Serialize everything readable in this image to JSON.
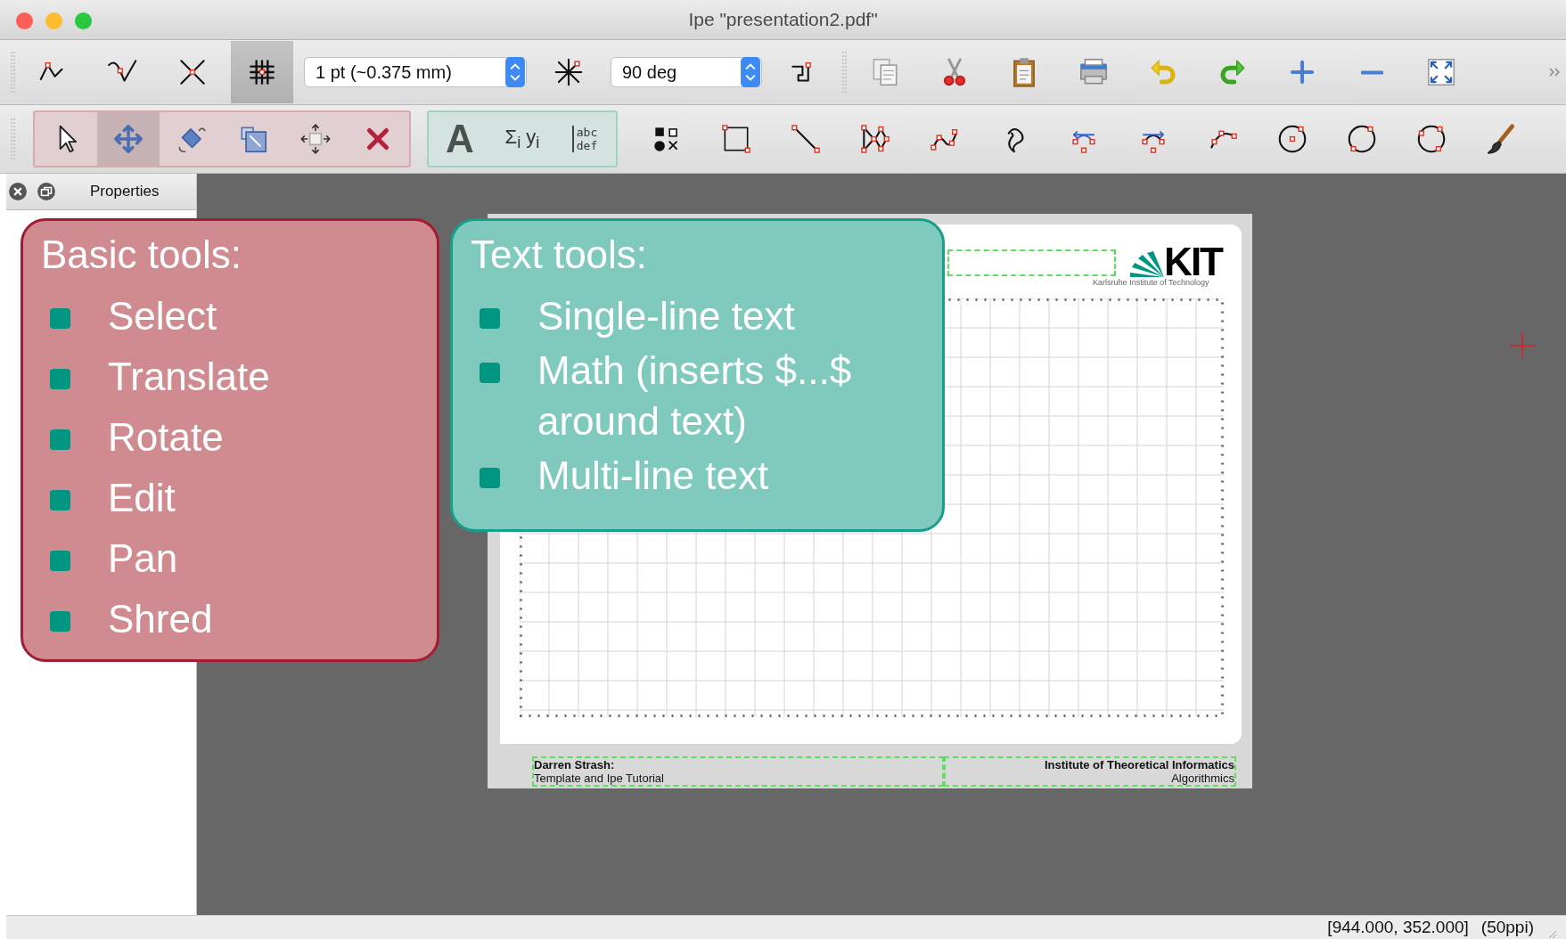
{
  "window": {
    "title": "Ipe \"presentation2.pdf\""
  },
  "snap_toggles": [
    {
      "on": false
    },
    {
      "on": false
    },
    {
      "on": false
    },
    {
      "on": true
    }
  ],
  "pen_width": {
    "value": "1 pt (~0.375 mm)"
  },
  "angle": {
    "value": "90 deg"
  },
  "tool_groups": [
    {
      "kind": "basic",
      "tools": [
        {
          "selected": false
        },
        {
          "selected": true
        },
        {
          "selected": false
        },
        {
          "selected": false
        },
        {
          "selected": false
        },
        {
          "selected": false
        }
      ]
    },
    {
      "kind": "text",
      "tools": [
        {
          "label": "A",
          "selected": false
        },
        {
          "label": "Σ$_{i}$ y$_{i}$",
          "selected": false
        },
        {
          "lines": [
            "abc",
            "def"
          ],
          "selected": false
        }
      ]
    },
    {
      "kind": "plain",
      "tools": [
        {
          "selected": false
        },
        {
          "selected": false
        },
        {
          "selected": false
        },
        {
          "selected": false
        },
        {
          "selected": false
        },
        {
          "selected": false
        },
        {
          "selected": false
        },
        {
          "selected": false
        },
        {
          "selected": false
        },
        {
          "selected": false
        },
        {
          "selected": false
        },
        {
          "selected": false
        },
        {
          "selected": false
        }
      ]
    }
  ],
  "sidebar": {
    "title": "Properties"
  },
  "page": {
    "logo": "KIT",
    "logo_subtitle": "Karlsruhe Institute of Technology",
    "footer_left": [
      "Darren Strash:",
      "Template and Ipe Tutorial"
    ],
    "footer_right": [
      "Institute of Theoretical Informatics",
      "Algorithmics"
    ]
  },
  "callouts": [
    {
      "kind": "basic",
      "title": "Basic tools:",
      "items": [
        "Select",
        "Translate",
        "Rotate",
        "Edit",
        "Pan",
        "Shred"
      ]
    },
    {
      "kind": "text",
      "title": "Text tools:",
      "items": [
        "Single-line text",
        "Math (inserts $...$ around text)",
        "Multi-line text"
      ]
    }
  ],
  "status_bar": {
    "coords": "[944.000, 352.000]",
    "resolution": "(50ppi)"
  }
}
